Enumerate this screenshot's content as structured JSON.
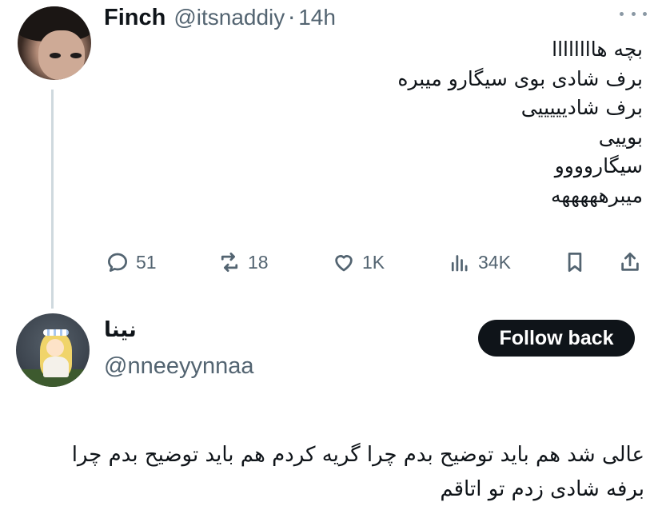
{
  "tweet": {
    "author_name": "Finch",
    "author_handle": "@itsnaddiy",
    "separator": "·",
    "time": "14h",
    "lines": [
      "بچه هاااااااا",
      "برف شادی بوی سیگارو میبره",
      "برف شادیییییی",
      "بوییی",
      "سیگاروووو",
      "میبرهههههه"
    ],
    "stats": {
      "replies": "51",
      "reposts": "18",
      "likes": "1K",
      "views": "34K"
    },
    "icons": [
      "reply-icon",
      "repost-icon",
      "like-icon",
      "views-icon",
      "bookmark-icon",
      "share-icon",
      "more-icon"
    ]
  },
  "profile": {
    "name": "نینا",
    "handle": "@nneeyynnaa",
    "follow_label": "Follow back",
    "bio": "عالی شد هم باید توضیح بدم چرا گریه کردم هم باید توضیح بدم چرا برفه شادی زدم تو اتاقم"
  },
  "colors": {
    "text": "#0f1419",
    "secondary": "#536471",
    "thread_line": "#cfd9de",
    "button_bg": "#0f1419",
    "button_text": "#ffffff"
  }
}
